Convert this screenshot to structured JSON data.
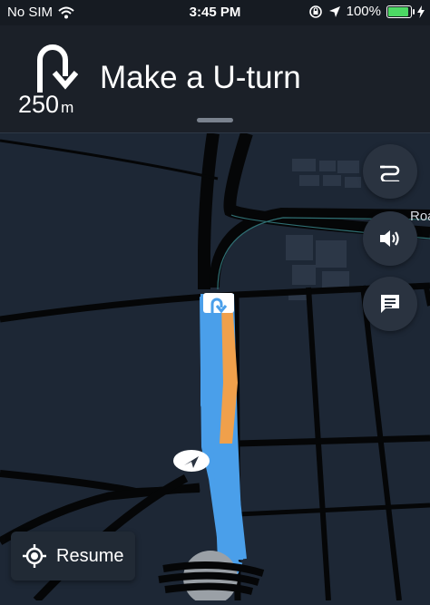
{
  "status_bar": {
    "carrier": "No SIM",
    "time": "3:45 PM",
    "battery_percent": "100%",
    "battery_level": 1.0,
    "icons": [
      "wifi-icon",
      "orientation-lock-icon",
      "location-arrow-icon",
      "battery-icon",
      "charging-bolt-icon"
    ]
  },
  "navigation": {
    "maneuver_icon": "u-turn-icon",
    "distance_value": "250",
    "distance_unit": "m",
    "instruction": "Make a U-turn"
  },
  "map": {
    "road_label": "Roa",
    "buttons": {
      "routes_icon": "alternate-routes-icon",
      "sound_icon": "volume-icon",
      "report_icon": "chat-report-icon"
    }
  },
  "resume": {
    "label": "Resume",
    "icon": "recenter-icon"
  },
  "colors": {
    "header_bg": "#1b2028",
    "map_bg": "#1d2735",
    "road": "#050607",
    "route_blue": "#4a9fea",
    "traffic_orange": "#f0a04b",
    "battery_green": "#4cd964",
    "button_bg": "#2a3340"
  }
}
